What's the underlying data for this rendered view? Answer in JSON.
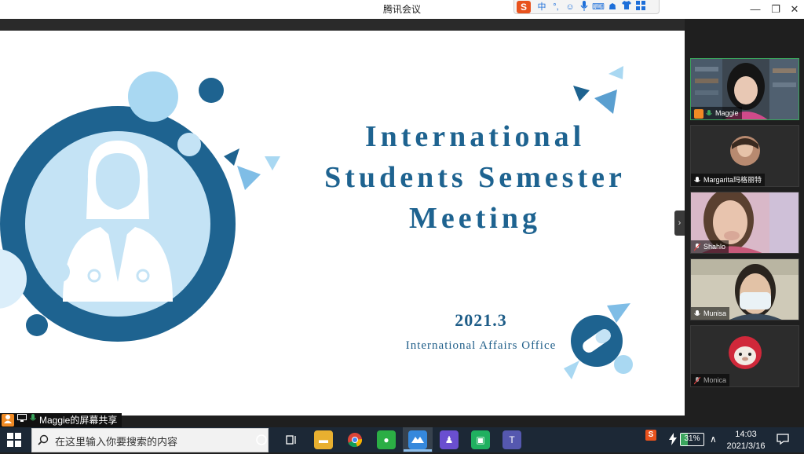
{
  "window": {
    "title": "腾讯会议",
    "controls": {
      "minimize": "—",
      "restore": "❐",
      "close": "✕"
    }
  },
  "ime_toolbar": {
    "logo": "S",
    "items": [
      "中",
      "°,",
      "☺",
      "mic",
      "⌨",
      "☗",
      "👕",
      "▦"
    ]
  },
  "slide": {
    "title_lines": [
      "International",
      "Students Semester",
      "Meeting"
    ],
    "date": "2021.3",
    "office": "International Affairs Office",
    "colors": {
      "dark_blue": "#1e6390",
      "mid_blue": "#2f86c2",
      "light_blue": "#a9d8f2",
      "pale_blue": "#dbeefa"
    }
  },
  "share_bar": {
    "label": "Maggie的屏幕共享"
  },
  "participants": [
    {
      "name": "Maggie",
      "active": true,
      "video": "video-feed",
      "mic_on": true
    },
    {
      "name": "Margarita玛格丽特",
      "active": false,
      "video": "avatar-photo",
      "mic_on": false
    },
    {
      "name": "Shahlo",
      "active": false,
      "video": "video-feed",
      "mic_on": false
    },
    {
      "name": "Munisa",
      "active": false,
      "video": "video-feed",
      "mic_on": false
    },
    {
      "name": "Monica",
      "active": false,
      "video": "avatar-cartoon",
      "mic_on": false
    }
  ],
  "taskbar": {
    "search_placeholder": "在这里输入你要搜索的内容",
    "apps": [
      "task-view",
      "explorer",
      "chrome",
      "wechat",
      "tencent-meeting",
      "app-purple",
      "app-green",
      "teams"
    ],
    "battery_percent": "31%",
    "time": "14:03",
    "date": "2021/3/16"
  }
}
